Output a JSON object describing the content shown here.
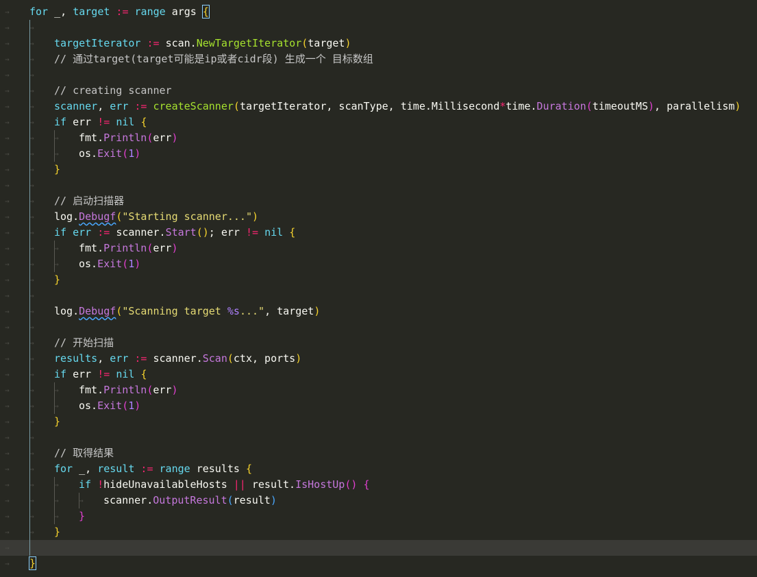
{
  "editor": {
    "language": "go",
    "theme_colors": {
      "background": "#272822",
      "current_line": "#3a3a36",
      "keyword": "#66d9ef",
      "function": "#a6e22e",
      "string": "#e6db74",
      "comment": "#c6c6c6"
    }
  },
  "lines": [
    {
      "indent": 1,
      "tokens": [
        [
          "kw",
          "for"
        ],
        [
          "pn",
          " _, "
        ],
        [
          "var",
          "target"
        ],
        [
          "op",
          " := "
        ],
        [
          "kw",
          "range"
        ],
        [
          "pn",
          " args "
        ],
        [
          "br-y",
          "{"
        ]
      ]
    },
    {
      "indent": 0,
      "tokens": []
    },
    {
      "indent": 2,
      "tokens": [
        [
          "var",
          "targetIterator"
        ],
        [
          "op",
          " := "
        ],
        [
          "pn",
          "scan."
        ],
        [
          "fn",
          "NewTargetIterator"
        ],
        [
          "br-y",
          "("
        ],
        [
          "pn",
          "target"
        ],
        [
          "br-y",
          ")"
        ]
      ]
    },
    {
      "indent": 2,
      "tokens": [
        [
          "cmt",
          "// 通过target(target可能是ip或者cidr段) 生成一个 目标数组"
        ]
      ]
    },
    {
      "indent": 0,
      "tokens": []
    },
    {
      "indent": 2,
      "tokens": [
        [
          "cmt",
          "// creating scanner"
        ]
      ]
    },
    {
      "indent": 2,
      "tokens": [
        [
          "var",
          "scanner"
        ],
        [
          "pn",
          ", "
        ],
        [
          "var",
          "err"
        ],
        [
          "op",
          " := "
        ],
        [
          "fn",
          "createScanner"
        ],
        [
          "br-y",
          "("
        ],
        [
          "pn",
          "targetIterator, scanType, time.Millisecond"
        ],
        [
          "op",
          "*"
        ],
        [
          "pn",
          "time."
        ],
        [
          "method",
          "Duration"
        ],
        [
          "br-p",
          "("
        ],
        [
          "pn",
          "timeoutMS"
        ],
        [
          "br-p",
          ")"
        ],
        [
          "pn",
          ", parallelism"
        ],
        [
          "br-y",
          ")"
        ]
      ]
    },
    {
      "indent": 2,
      "tokens": [
        [
          "kw",
          "if"
        ],
        [
          "pn",
          " err "
        ],
        [
          "op",
          "!="
        ],
        [
          "pn",
          " "
        ],
        [
          "nil",
          "nil"
        ],
        [
          "pn",
          " "
        ],
        [
          "br-y",
          "{"
        ]
      ]
    },
    {
      "indent": 3,
      "tokens": [
        [
          "pn",
          "fmt."
        ],
        [
          "method",
          "Println"
        ],
        [
          "br-p",
          "("
        ],
        [
          "pn",
          "err"
        ],
        [
          "br-p",
          ")"
        ]
      ]
    },
    {
      "indent": 3,
      "tokens": [
        [
          "pn",
          "os."
        ],
        [
          "method",
          "Exit"
        ],
        [
          "br-p",
          "("
        ],
        [
          "num",
          "1"
        ],
        [
          "br-p",
          ")"
        ]
      ]
    },
    {
      "indent": 2,
      "tokens": [
        [
          "br-y",
          "}"
        ]
      ]
    },
    {
      "indent": 0,
      "tokens": []
    },
    {
      "indent": 2,
      "tokens": [
        [
          "cmt",
          "// 启动扫描器"
        ]
      ]
    },
    {
      "indent": 2,
      "tokens": [
        [
          "pn",
          "log."
        ],
        [
          "method squig",
          "Debugf"
        ],
        [
          "br-y",
          "("
        ],
        [
          "str",
          "\"Starting scanner...\""
        ],
        [
          "br-y",
          ")"
        ]
      ]
    },
    {
      "indent": 2,
      "tokens": [
        [
          "kw",
          "if"
        ],
        [
          "pn",
          " "
        ],
        [
          "var",
          "err"
        ],
        [
          "op",
          " := "
        ],
        [
          "pn",
          "scanner."
        ],
        [
          "method",
          "Start"
        ],
        [
          "br-y",
          "()"
        ],
        [
          "pn",
          "; err "
        ],
        [
          "op",
          "!="
        ],
        [
          "pn",
          " "
        ],
        [
          "nil",
          "nil"
        ],
        [
          "pn",
          " "
        ],
        [
          "br-y",
          "{"
        ]
      ]
    },
    {
      "indent": 3,
      "tokens": [
        [
          "pn",
          "fmt."
        ],
        [
          "method",
          "Println"
        ],
        [
          "br-p",
          "("
        ],
        [
          "pn",
          "err"
        ],
        [
          "br-p",
          ")"
        ]
      ]
    },
    {
      "indent": 3,
      "tokens": [
        [
          "pn",
          "os."
        ],
        [
          "method",
          "Exit"
        ],
        [
          "br-p",
          "("
        ],
        [
          "num",
          "1"
        ],
        [
          "br-p",
          ")"
        ]
      ]
    },
    {
      "indent": 2,
      "tokens": [
        [
          "br-y",
          "}"
        ]
      ]
    },
    {
      "indent": 0,
      "tokens": []
    },
    {
      "indent": 2,
      "tokens": [
        [
          "pn",
          "log."
        ],
        [
          "method squig",
          "Debugf"
        ],
        [
          "br-y",
          "("
        ],
        [
          "str",
          "\"Scanning target "
        ],
        [
          "fmt",
          "%s"
        ],
        [
          "str",
          "...\""
        ],
        [
          "pn",
          ", target"
        ],
        [
          "br-y",
          ")"
        ]
      ]
    },
    {
      "indent": 0,
      "tokens": []
    },
    {
      "indent": 2,
      "tokens": [
        [
          "cmt",
          "// 开始扫描"
        ]
      ]
    },
    {
      "indent": 2,
      "tokens": [
        [
          "var",
          "results"
        ],
        [
          "pn",
          ", "
        ],
        [
          "var",
          "err"
        ],
        [
          "op",
          " := "
        ],
        [
          "pn",
          "scanner."
        ],
        [
          "method",
          "Scan"
        ],
        [
          "br-y",
          "("
        ],
        [
          "pn",
          "ctx, ports"
        ],
        [
          "br-y",
          ")"
        ]
      ]
    },
    {
      "indent": 2,
      "tokens": [
        [
          "kw",
          "if"
        ],
        [
          "pn",
          " err "
        ],
        [
          "op",
          "!="
        ],
        [
          "pn",
          " "
        ],
        [
          "nil",
          "nil"
        ],
        [
          "pn",
          " "
        ],
        [
          "br-y",
          "{"
        ]
      ]
    },
    {
      "indent": 3,
      "tokens": [
        [
          "pn",
          "fmt."
        ],
        [
          "method",
          "Println"
        ],
        [
          "br-p",
          "("
        ],
        [
          "pn",
          "err"
        ],
        [
          "br-p",
          ")"
        ]
      ]
    },
    {
      "indent": 3,
      "tokens": [
        [
          "pn",
          "os."
        ],
        [
          "method",
          "Exit"
        ],
        [
          "br-p",
          "("
        ],
        [
          "num",
          "1"
        ],
        [
          "br-p",
          ")"
        ]
      ]
    },
    {
      "indent": 2,
      "tokens": [
        [
          "br-y",
          "}"
        ]
      ]
    },
    {
      "indent": 0,
      "tokens": []
    },
    {
      "indent": 2,
      "tokens": [
        [
          "cmt",
          "// 取得结果"
        ]
      ]
    },
    {
      "indent": 2,
      "tokens": [
        [
          "kw",
          "for"
        ],
        [
          "pn",
          " _, "
        ],
        [
          "var",
          "result"
        ],
        [
          "op",
          " := "
        ],
        [
          "kw",
          "range"
        ],
        [
          "pn",
          " results "
        ],
        [
          "br-y",
          "{"
        ]
      ]
    },
    {
      "indent": 3,
      "tokens": [
        [
          "kw",
          "if"
        ],
        [
          "pn",
          " "
        ],
        [
          "op",
          "!"
        ],
        [
          "pn",
          "hideUnavailableHosts "
        ],
        [
          "op",
          "||"
        ],
        [
          "pn",
          " result."
        ],
        [
          "method",
          "IsHostUp"
        ],
        [
          "br-p",
          "()"
        ],
        [
          "pn",
          " "
        ],
        [
          "br-p",
          "{"
        ]
      ]
    },
    {
      "indent": 4,
      "tokens": [
        [
          "pn",
          "scanner."
        ],
        [
          "method",
          "OutputResult"
        ],
        [
          "br-b",
          "("
        ],
        [
          "pn",
          "result"
        ],
        [
          "br-b",
          ")"
        ]
      ]
    },
    {
      "indent": 3,
      "tokens": [
        [
          "br-p",
          "}"
        ]
      ]
    },
    {
      "indent": 2,
      "tokens": [
        [
          "br-y",
          "}"
        ]
      ]
    },
    {
      "indent": 0,
      "tokens": []
    },
    {
      "indent": 1,
      "tokens": [
        [
          "br-y",
          "}"
        ]
      ]
    }
  ]
}
